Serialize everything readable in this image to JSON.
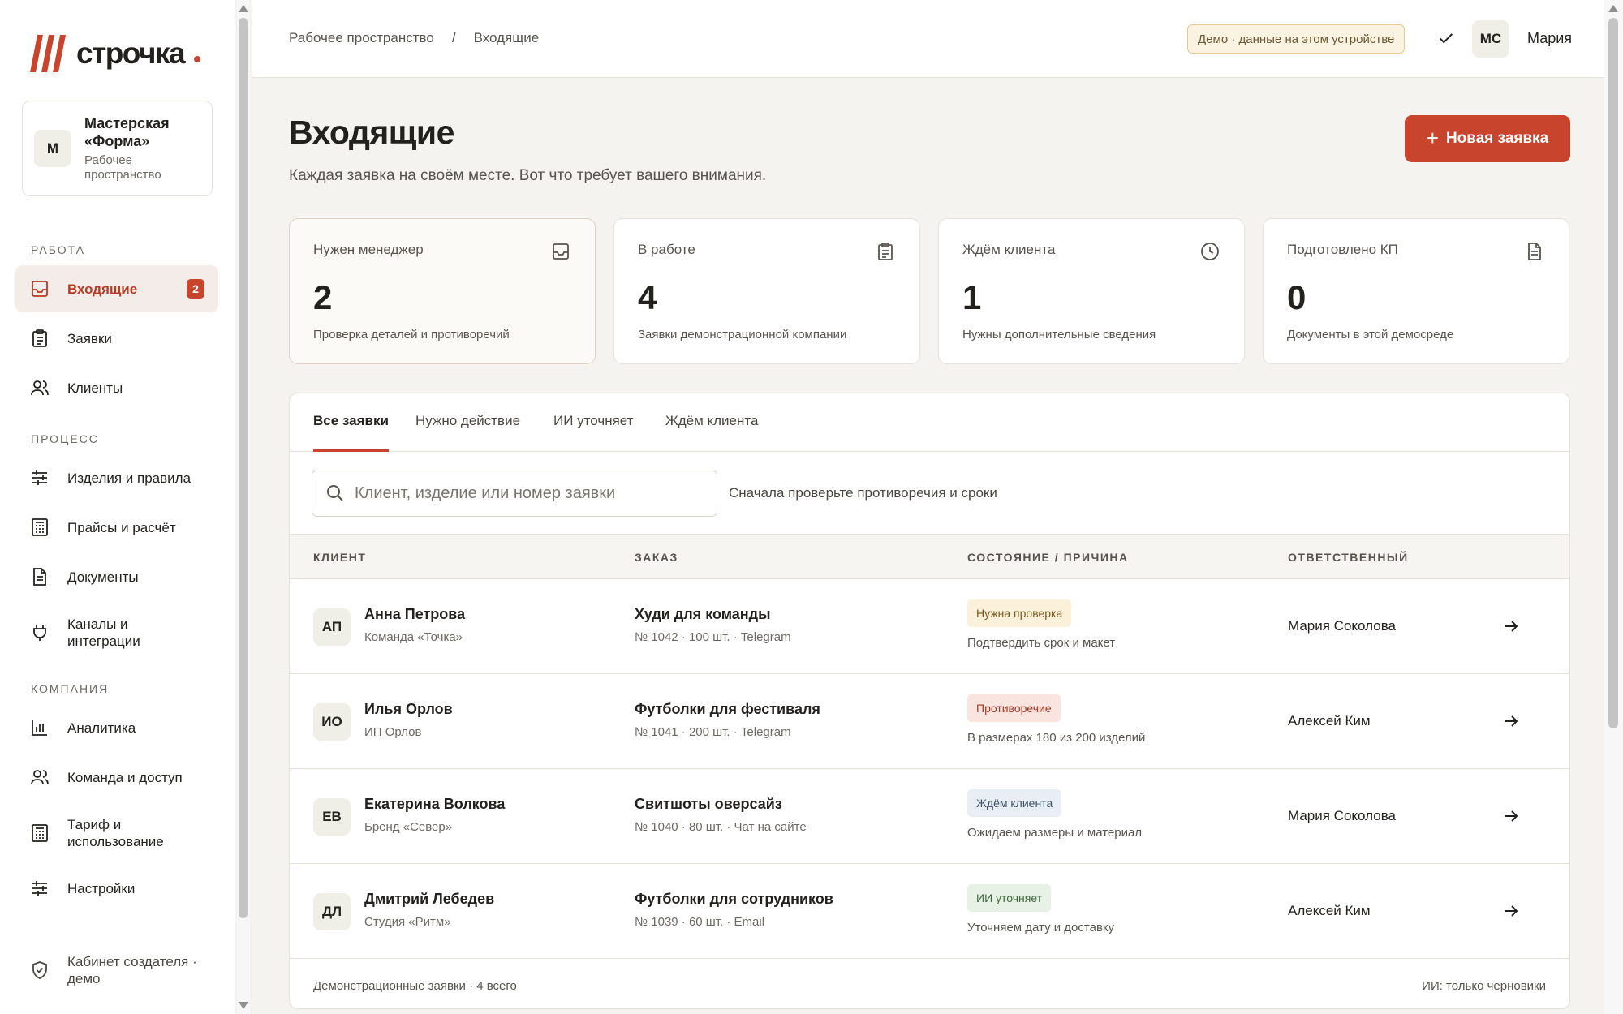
{
  "app": {
    "wordmark": "строчка"
  },
  "workspace": {
    "initial": "М",
    "name": "Мастерская «Форма»",
    "sub": "Рабочее пространство"
  },
  "sidebar": {
    "sections": {
      "work": "РАБОТА",
      "process": "ПРОЦЕСС",
      "company": "КОМПАНИЯ"
    },
    "items": [
      {
        "label": "Входящие",
        "icon": "inbox-icon",
        "active": true,
        "badge": "2"
      },
      {
        "label": "Заявки",
        "icon": "clipboard-icon"
      },
      {
        "label": "Клиенты",
        "icon": "users-icon"
      },
      {
        "label": "Изделия и правила",
        "icon": "sliders-icon"
      },
      {
        "label": "Прайсы и расчёт",
        "icon": "calculator-icon"
      },
      {
        "label": "Документы",
        "icon": "document-icon"
      },
      {
        "label": "Каналы и интеграции",
        "icon": "plug-icon"
      },
      {
        "label": "Аналитика",
        "icon": "bar-chart-icon"
      },
      {
        "label": "Команда и доступ",
        "icon": "team-icon"
      },
      {
        "label": "Тариф и использование",
        "icon": "receipt-icon"
      },
      {
        "label": "Настройки",
        "icon": "settings-sliders-icon"
      }
    ],
    "bottom": {
      "label": "Кабинет создателя · демо",
      "icon": "shield-check-icon"
    }
  },
  "topbar": {
    "breadcrumb": [
      "Рабочее пространство",
      "/",
      "Входящие"
    ],
    "demo_badge": "Демо · данные на этом устройстве",
    "user_initials": "МС",
    "user_name": "Мария"
  },
  "main": {
    "title": "Входящие",
    "subtitle": "Каждая заявка на своём месте. Вот что требует вашего внимания.",
    "new_button": "Новая заявка",
    "new_button_plus": "+",
    "stats": [
      {
        "label": "Нужен менеджер",
        "value": "2",
        "desc": "Проверка деталей и противоречий",
        "icon": "inbox-icon"
      },
      {
        "label": "В работе",
        "value": "4",
        "desc": "Заявки демонстрационной компании",
        "icon": "clipboard-icon"
      },
      {
        "label": "Ждём клиента",
        "value": "1",
        "desc": "Нужны дополнительные сведения",
        "icon": "clock-icon"
      },
      {
        "label": "Подготовлено КП",
        "value": "0",
        "desc": "Документы в этой демосреде",
        "icon": "document-icon"
      }
    ],
    "tabs": [
      "Все заявки",
      "Нужно действие",
      "ИИ уточняет",
      "Ждём клиента"
    ],
    "search": {
      "placeholder": "Клиент, изделие или номер заявки",
      "value": ""
    },
    "search_hint": "Сначала проверьте противоречия и сроки",
    "columns": [
      "КЛИЕНТ",
      "ЗАКАЗ",
      "СОСТОЯНИЕ / ПРИЧИНА",
      "ОТВЕТСТВЕННЫЙ"
    ],
    "rows": [
      {
        "initials": "АП",
        "client": "Анна Петрова",
        "company": "Команда «Точка»",
        "order": "Худи для команды",
        "meta": "№ 1042 · 100 шт. · Telegram",
        "status": "Нужна проверка",
        "reason": "Подтвердить срок и макет",
        "owner": "Мария Соколова"
      },
      {
        "initials": "ИО",
        "client": "Илья Орлов",
        "company": "ИП Орлов",
        "order": "Футболки для фестиваля",
        "meta": "№ 1041 · 200 шт. · Telegram",
        "status": "Противоречие",
        "reason": "В размерах 180 из 200 изделий",
        "owner": "Алексей Ким"
      },
      {
        "initials": "ЕВ",
        "client": "Екатерина Волкова",
        "company": "Бренд «Север»",
        "order": "Свитшоты оверсайз",
        "meta": "№ 1040 · 80 шт. · Чат на сайте",
        "status": "Ждём клиента",
        "reason": "Ожидаем размеры и материал",
        "owner": "Мария Соколова"
      },
      {
        "initials": "ДЛ",
        "client": "Дмитрий Лебедев",
        "company": "Студия «Ритм»",
        "order": "Футболки для сотрудников",
        "meta": "№ 1039 · 60 шт. · Email",
        "status": "ИИ уточняет",
        "reason": "Уточняем дату и доставку",
        "owner": "Алексей Ким"
      }
    ],
    "footer_left": "Демонстрационные заявки · 4 всего",
    "footer_right": "ИИ: только черновики"
  },
  "colors": {
    "accent": "#c8442c",
    "status_review_bg": "#fbf0d9",
    "status_review_fg": "#7a5a1e",
    "status_conflict_bg": "#f9e4df",
    "status_conflict_fg": "#a33a25",
    "status_wait_bg": "#e8eef4",
    "status_wait_fg": "#3f5366",
    "status_ai_bg": "#e7f1e6",
    "status_ai_fg": "#3f6a3c"
  }
}
